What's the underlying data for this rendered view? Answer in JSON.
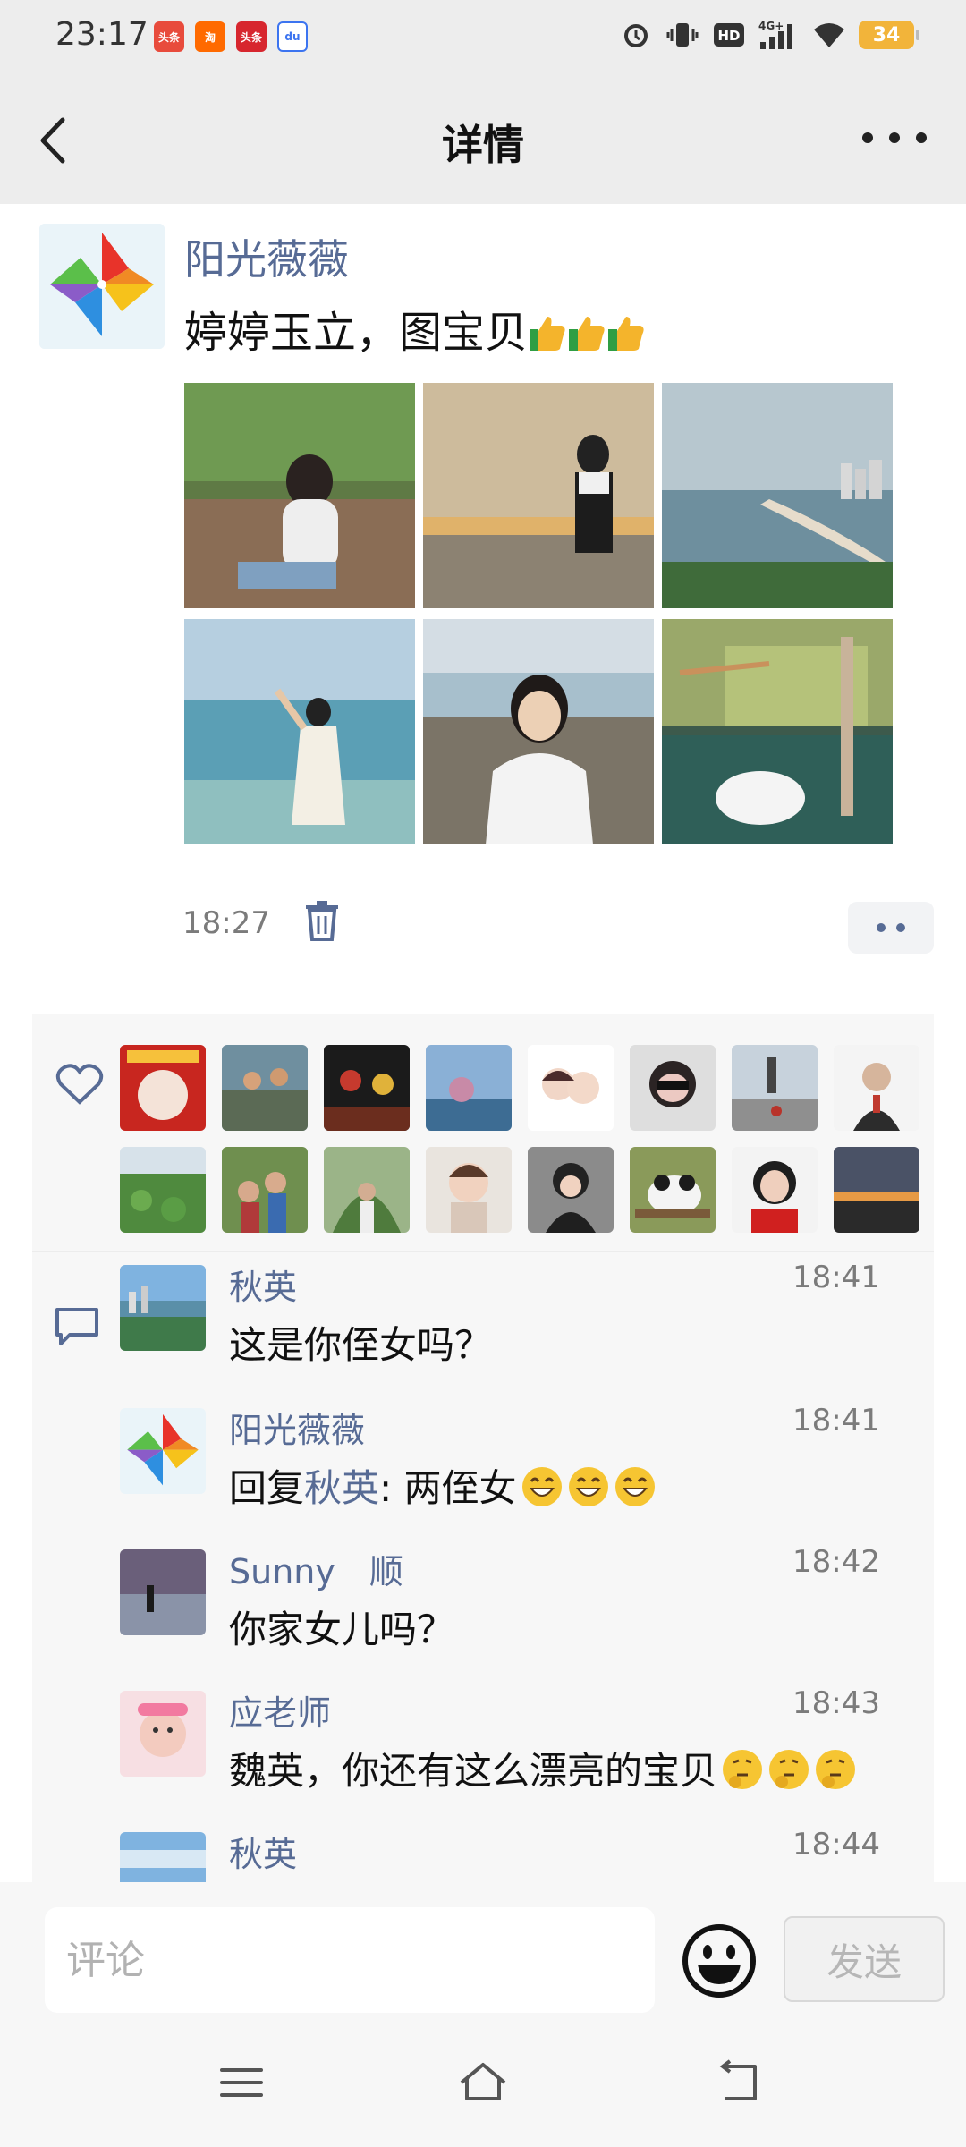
{
  "status_bar": {
    "time": "23:17",
    "app_icons": [
      {
        "name": "toutiao-icon",
        "label": "头条",
        "color": "#e84b3c"
      },
      {
        "name": "taobao-icon",
        "label": "淘",
        "color": "#ff6a00"
      },
      {
        "name": "news-icon",
        "label": "头条",
        "color": "#d7262e"
      },
      {
        "name": "baidu-icon",
        "label": "du",
        "color": "#3c74f0"
      }
    ],
    "network": "4G+",
    "hd": "HD",
    "battery": "34"
  },
  "nav": {
    "title": "详情"
  },
  "post": {
    "author": "阳光薇薇",
    "text": "婷婷玉立，图宝贝",
    "time": "18:27",
    "thumb_count": 3
  },
  "likes": {
    "count": 16
  },
  "comments": [
    {
      "name": "秋英",
      "time": "18:41",
      "text": "这是你侄女吗？",
      "reply_prefix": "",
      "reply_to": "",
      "emoji": "",
      "emoji_count": 0,
      "avatar": "city"
    },
    {
      "name": "阳光薇薇",
      "time": "18:41",
      "text": "两侄女",
      "reply_prefix": "回复",
      "reply_to": "秋英",
      "emoji": "grin",
      "emoji_count": 3,
      "avatar": "pinwheel"
    },
    {
      "name": "Sunny　顺",
      "time": "18:42",
      "text": "你家女儿吗？",
      "reply_prefix": "",
      "reply_to": "",
      "emoji": "",
      "emoji_count": 0,
      "avatar": "sunset"
    },
    {
      "name": "应老师",
      "time": "18:43",
      "text": "魏英，你还有这么漂亮的宝贝",
      "reply_prefix": "",
      "reply_to": "",
      "emoji": "thinking",
      "emoji_count": 3,
      "avatar": "baby"
    },
    {
      "name": "秋英",
      "time": "18:44",
      "text": "",
      "reply_prefix": "",
      "reply_to": "",
      "emoji": "",
      "emoji_count": 0,
      "avatar": "sky"
    }
  ],
  "input": {
    "placeholder": "评论",
    "send_label": "发送"
  }
}
